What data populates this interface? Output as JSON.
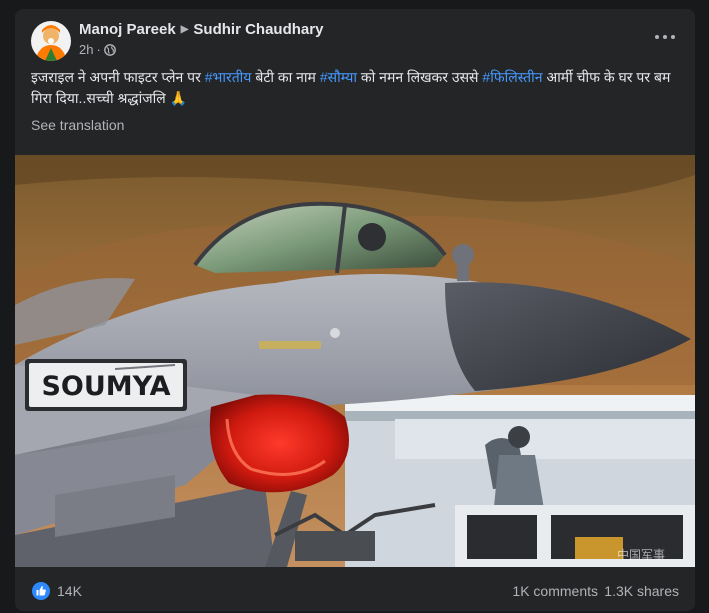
{
  "post": {
    "author": "Manoj Pareek",
    "target": "Sudhir Chaudhary",
    "time": "2h",
    "text_parts": {
      "p1": "इजराइल ने अपनी फाइटर प्लेन पर ",
      "tag1": "#भारतीय",
      "p2": " बेटी का नाम ",
      "tag2": "#सौम्या",
      "p3": " को नमन लिखकर उससे ",
      "tag3": "#फिलिस्तीन",
      "p4": " आर्मी चीफ के घर पर बम गिरा दिया..सच्ची श्रद्धांजलि 🙏"
    },
    "see_translation": "See translation",
    "photo": {
      "nose_text": "SOUMYA",
      "watermark": "中国军事"
    }
  },
  "stats": {
    "reactions": "14K",
    "comments": "1K comments",
    "shares": "1.3K shares"
  },
  "icons": {
    "privacy": "globe-icon",
    "menu": "more-horizontal-icon",
    "reaction": "like-icon"
  },
  "colors": {
    "background": "#18191a",
    "card": "#242526",
    "text": "#e4e6eb",
    "secondary_text": "#b0b3b8",
    "hashtag": "#4599ff",
    "like_blue": "#2e89ff"
  }
}
